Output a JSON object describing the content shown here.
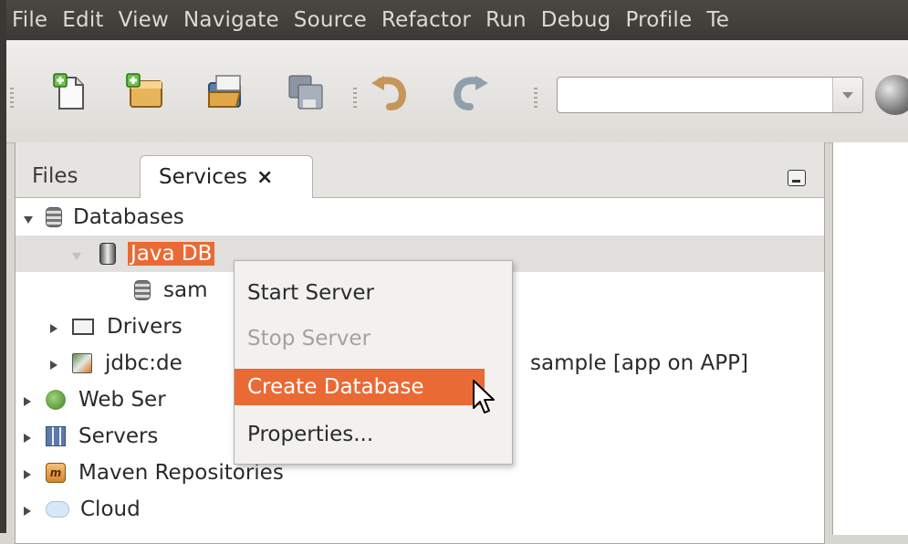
{
  "menubar": {
    "items": [
      "File",
      "Edit",
      "View",
      "Navigate",
      "Source",
      "Refactor",
      "Run",
      "Debug",
      "Profile",
      "Te"
    ]
  },
  "toolbar": {
    "icons": [
      "new-file-icon",
      "new-project-icon",
      "open-project-icon",
      "save-all-icon",
      "undo-icon",
      "redo-icon",
      "globe-icon"
    ],
    "search_value": ""
  },
  "panel": {
    "tabs": [
      {
        "label": "Files"
      },
      {
        "label": "Services",
        "close": "×"
      }
    ]
  },
  "tree": {
    "databases": "Databases",
    "javadb": "Java DB",
    "sample": "sam",
    "drivers": "Drivers",
    "jdbc_prefix": "jdbc:de",
    "jdbc_suffix": "sample [app on APP]",
    "web_services": "Web Ser",
    "servers": "Servers",
    "maven": "Maven Repositories",
    "cloud": "Cloud",
    "maven_icon_text": "m"
  },
  "context_menu": {
    "items": [
      {
        "label": "Start Server",
        "enabled": true
      },
      {
        "label": "Stop Server",
        "enabled": false
      },
      {
        "label": "Create Database",
        "enabled": true,
        "highlighted": true
      },
      {
        "label": "Properties...",
        "enabled": true
      }
    ]
  },
  "colors": {
    "accent": "#ea6a35",
    "menubar_bg": "#3c3a36"
  }
}
